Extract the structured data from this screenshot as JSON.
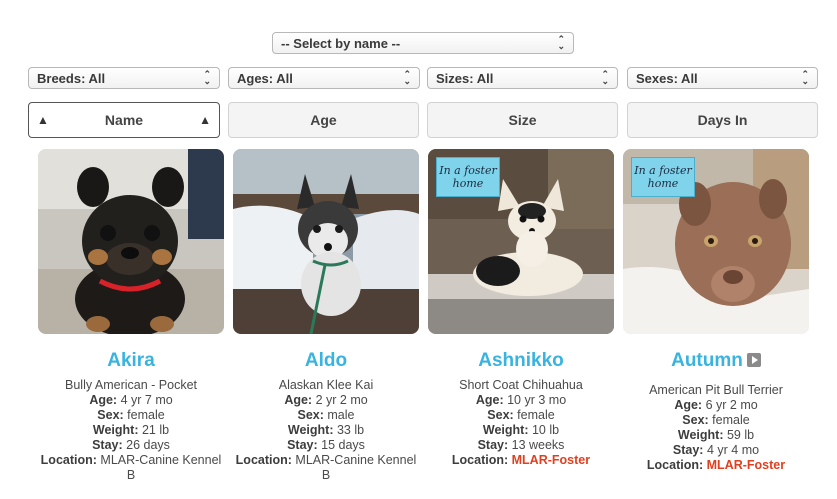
{
  "filters": {
    "name_select": "-- Select by name --",
    "breeds": "Breeds: All",
    "ages": "Ages: All",
    "sizes": "Sizes: All",
    "sexes": "Sexes: All"
  },
  "sort": {
    "name": "Name",
    "age": "Age",
    "size": "Size",
    "days_in": "Days In",
    "active": "Name",
    "arrow": "▲"
  },
  "labels": {
    "age": "Age:",
    "sex": "Sex:",
    "weight": "Weight:",
    "stay": "Stay:",
    "location": "Location:"
  },
  "badge_text": "In a foster home",
  "dogs": [
    {
      "name": "Akira",
      "breed": "Bully American - Pocket",
      "age": "4 yr 7 mo",
      "sex": "female",
      "weight": "21 lb",
      "stay": "26 days",
      "location": "MLAR-Canine Kennel B",
      "foster": false,
      "video": false
    },
    {
      "name": "Aldo",
      "breed": "Alaskan Klee Kai",
      "age": "2 yr 2 mo",
      "sex": "male",
      "weight": "33 lb",
      "stay": "15 days",
      "location": "MLAR-Canine Kennel B",
      "foster": false,
      "video": false
    },
    {
      "name": "Ashnikko",
      "breed": "Short Coat Chihuahua",
      "age": "10 yr 3 mo",
      "sex": "female",
      "weight": "10 lb",
      "stay": "13 weeks",
      "location": "MLAR-Foster",
      "foster": true,
      "video": false
    },
    {
      "name": "Autumn",
      "breed": "American Pit Bull Terrier",
      "age": "6 yr 2 mo",
      "sex": "female",
      "weight": "59 lb",
      "stay": "4 yr 4 mo",
      "location": "MLAR-Foster",
      "foster": true,
      "video": true
    }
  ]
}
